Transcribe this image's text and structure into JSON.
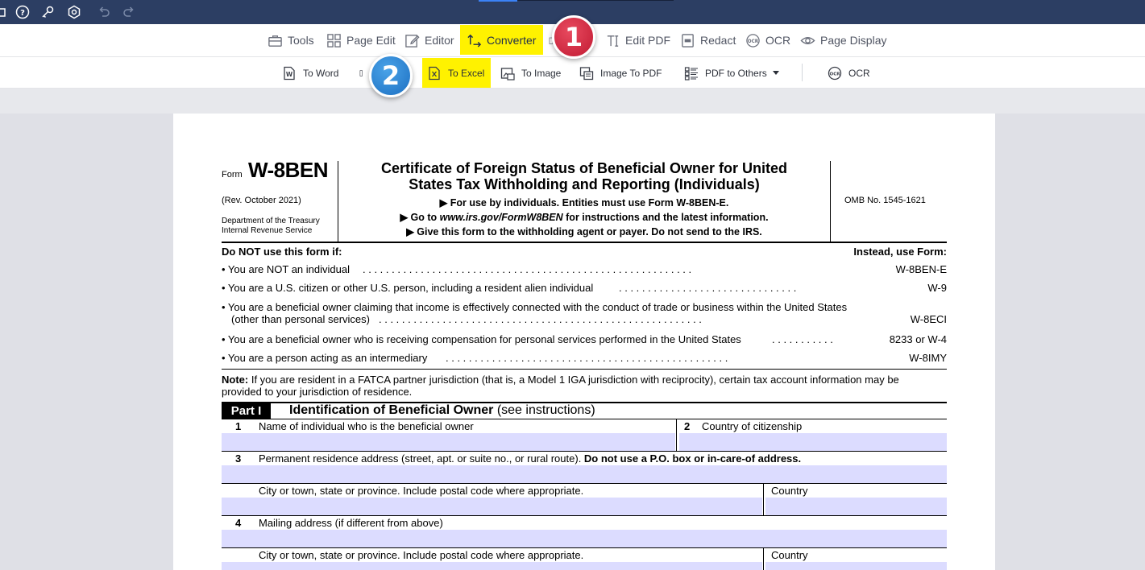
{
  "toolbar": {
    "items": [
      {
        "label": "Tools",
        "icon": "toolbox-icon"
      },
      {
        "label": "Page Edit",
        "icon": "grid-icon"
      },
      {
        "label": "Editor",
        "icon": "edit-icon"
      },
      {
        "label": "Converter",
        "icon": "convert-icon",
        "active": true
      },
      {
        "label": "Edit PDF",
        "icon": "text-cursor-icon"
      },
      {
        "label": "Redact",
        "icon": "redact-icon"
      },
      {
        "label": "OCR",
        "icon": "ocr-icon"
      },
      {
        "label": "Page Display",
        "icon": "eye-icon"
      }
    ],
    "highlight_color": "#fff200"
  },
  "subtoolbar": {
    "to_word": "To Word",
    "to_excel": "To Excel",
    "to_image": "To Image",
    "image_to_pdf": "Image To PDF",
    "pdf_to_others": "PDF to Others",
    "ocr": "OCR"
  },
  "badges": {
    "one": "1",
    "two": "2"
  },
  "form": {
    "form_word": "Form",
    "form_number": "W-8BEN",
    "rev": "(Rev. October  2021)",
    "dept1": "Department of the Treasury",
    "dept2": "Internal Revenue Service",
    "title1": "Certificate of Foreign Status of Beneficial Owner for United",
    "title2": "States Tax Withholding and Reporting (Individuals)",
    "sub1": "▶ For use by individuals. Entities must use Form W-8BEN-E.",
    "sub2_pre": "▶ Go to ",
    "sub2_url": "www.irs.gov/FormW8BEN",
    "sub2_post": " for instructions and the latest information.",
    "sub3": "▶ Give this form to the withholding agent or payer. Do not send to the IRS.",
    "omb": "OMB No. 1545-1621",
    "do_not_use": "Do NOT use this form if:",
    "instead": "Instead, use Form:",
    "bullets": [
      {
        "text": "• You are NOT an individual",
        "form": "W-8BEN-E"
      },
      {
        "text": "• You are a U.S. citizen or other U.S. person, including a resident alien individual",
        "form": "W-9"
      },
      {
        "text": "• You are a beneficial owner claiming that income is effectively connected with the conduct of trade or business within the United States",
        "text2": "(other than personal services)",
        "form": "W-8ECI"
      },
      {
        "text": "• You are a beneficial owner who is receiving compensation for personal services performed in the United States",
        "form": "8233 or W-4"
      },
      {
        "text": "• You are a person acting as an intermediary",
        "form": "W-8IMY"
      }
    ],
    "note_label": "Note:",
    "note_text": " If you are resident in a FATCA partner jurisdiction (that is, a Model 1 IGA jurisdiction with reciprocity), certain tax account information may be",
    "note_text2": "provided to your jurisdiction of residence.",
    "part_label": "Part I",
    "part_title": "Identification of Beneficial Owner",
    "part_hint": " (see instructions)",
    "line1_num": "1",
    "line1": "Name of individual who is the beneficial owner",
    "line2_num": "2",
    "line2": "Country of citizenship",
    "line3_num": "3",
    "line3": "Permanent residence address (street, apt. or suite no., or rural route). ",
    "line3_bold": "Do not use a P.O. box or in-care-of address.",
    "city": "City or town, state or province. Include postal code where appropriate.",
    "country": "Country",
    "line4_num": "4",
    "line4": "Mailing address (if different from above)",
    "city2": "City or town, state or province. Include postal code where appropriate.",
    "country2": "Country"
  }
}
